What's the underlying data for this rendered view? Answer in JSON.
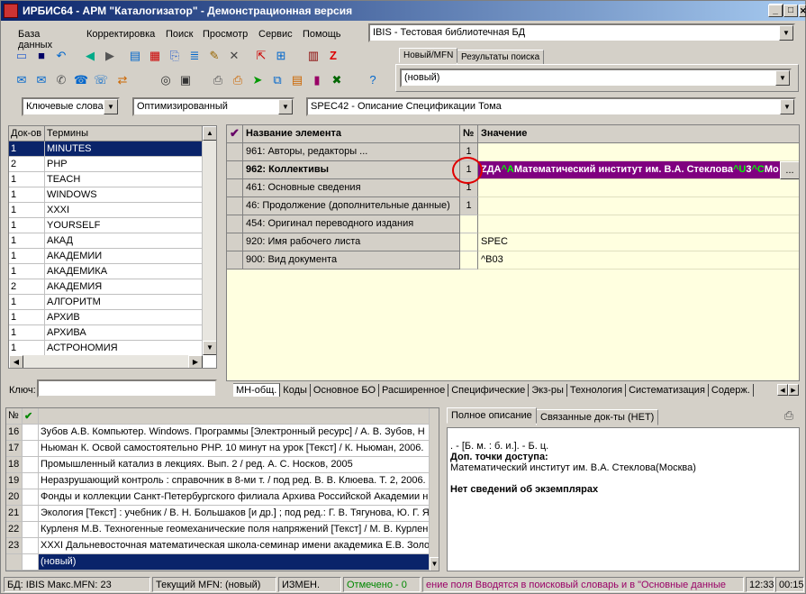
{
  "window": {
    "title": "ИРБИС64 - АРМ \"Каталогизатор\" - Демонстрационная версия"
  },
  "menu": [
    "База данных",
    "Корректировка",
    "Поиск",
    "Просмотр",
    "Сервис",
    "Помощь"
  ],
  "db_combo": {
    "value": "IBIS - Тестовая библиотечная БД"
  },
  "right_tabs": [
    "Новый/MFN",
    "Результаты поиска"
  ],
  "mfn_combo": {
    "value": "(новый)"
  },
  "filters": {
    "dictionary": "Ключевые слова",
    "mode": "Оптимизированный",
    "worksheet": "SPEC42 - Описание Спецификации Тома"
  },
  "terms": {
    "headers": [
      "Док-ов",
      "Термины"
    ],
    "rows": [
      {
        "count": "1",
        "term": "MINUTES"
      },
      {
        "count": "2",
        "term": "PHP"
      },
      {
        "count": "1",
        "term": "TEACH"
      },
      {
        "count": "1",
        "term": "WINDOWS"
      },
      {
        "count": "1",
        "term": "XXXI"
      },
      {
        "count": "1",
        "term": "YOURSELF"
      },
      {
        "count": "1",
        "term": "АКАД"
      },
      {
        "count": "1",
        "term": "АКАДЕМИИ"
      },
      {
        "count": "1",
        "term": "АКАДЕМИКА"
      },
      {
        "count": "2",
        "term": "АКАДЕМИЯ"
      },
      {
        "count": "1",
        "term": "АЛГОРИТМ"
      },
      {
        "count": "1",
        "term": "АРХИВ"
      },
      {
        "count": "1",
        "term": "АРХИВА"
      },
      {
        "count": "1",
        "term": "АСТРОНОМИЯ"
      }
    ],
    "key_label": "Ключ:"
  },
  "fields": {
    "headers": [
      "Название элемента",
      "№",
      "Значение"
    ],
    "rows": [
      {
        "name": "961: Авторы, редакторы ...",
        "num": "1",
        "value": ""
      },
      {
        "name": "962: Коллективы",
        "num": "1",
        "value": "ZДА^AМатематический институт им. В.А. Стеклова^U3^CMo"
      },
      {
        "name": "461: Основные сведения",
        "num": "1",
        "value": ""
      },
      {
        "name": "46: Продолжение (дополнительные данные)",
        "num": "1",
        "value": ""
      },
      {
        "name": "454: Оригинал переводного издания",
        "num": "",
        "value": ""
      },
      {
        "name": "920: Имя рабочего листа",
        "num": "",
        "value": "SPEC"
      },
      {
        "name": "900: Вид документа",
        "num": "",
        "value": "^B03"
      }
    ],
    "edit_button": "..."
  },
  "bottom_tabs": [
    "МН-общ.",
    "Коды",
    "Основное БО",
    "Расширенное",
    "Специфические",
    "Экз-ры",
    "Технология",
    "Систематизация",
    "Содерж."
  ],
  "records": {
    "headers": [
      "№",
      "✔"
    ],
    "rows": [
      {
        "num": "16",
        "text": "Зубов А.В. Компьютер. Windows. Программы [Электронный ресурс] / А. В. Зубов, Н"
      },
      {
        "num": "17",
        "text": "Ньюман К. Освой самостоятельно PHP. 10 минут на урок [Текст] / К. Ньюман, 2006."
      },
      {
        "num": "18",
        "text": "Промышленный катализ в лекциях. Вып. 2 / ред. А. С. Носков, 2005"
      },
      {
        "num": "19",
        "text": "Неразрушающий контроль : справочник в 8-ми т. / под ред. В. В. Клюева. Т. 2, 2006."
      },
      {
        "num": "20",
        "text": "Фонды и коллекции Санкт-Петербургского филиала Архива Российской Академии н"
      },
      {
        "num": "21",
        "text": "Экология [Текст] : учебник / В. Н. Большаков [и др.] ; под ред.: Г. В. Тягунова, Ю. Г. Я"
      },
      {
        "num": "22",
        "text": "Курленя М.В. Техногенные геомеханические поля напряжений [Текст] / М. В. Курлен"
      },
      {
        "num": "23",
        "text": "XXXI Дальневосточная математическая школа-семинар имени академика Е.В. Золо"
      },
      {
        "num": "",
        "text": "(новый)"
      }
    ]
  },
  "desc_tabs": [
    "Полное описание",
    "Связанные док-ты (НЕТ)"
  ],
  "description": {
    "line1": ". - [Б. м. : б. и.]. - Б. ц.",
    "line2": "Доп. точки доступа:",
    "line3": "Математический институт им. В.А. Стеклова(Москва)",
    "line4": "Нет сведений об экземплярах"
  },
  "statusbar": {
    "db": "БД: IBIS Макс.MFN: 23",
    "current": "Текущий MFN: (новый)",
    "changed": "ИЗМЕН.",
    "marked": "Отмечено - 0",
    "hint": "ение поля    Вводятся в поисковый словарь и в \"Основные данные",
    "time": "12:33",
    "clock": "00:15"
  },
  "colors": {
    "selection": "#0a246a",
    "grid_bg": "#ffffe0",
    "edit_row": "#800080",
    "marker_green": "#00ff00",
    "highlight_circle": "#e00000"
  }
}
